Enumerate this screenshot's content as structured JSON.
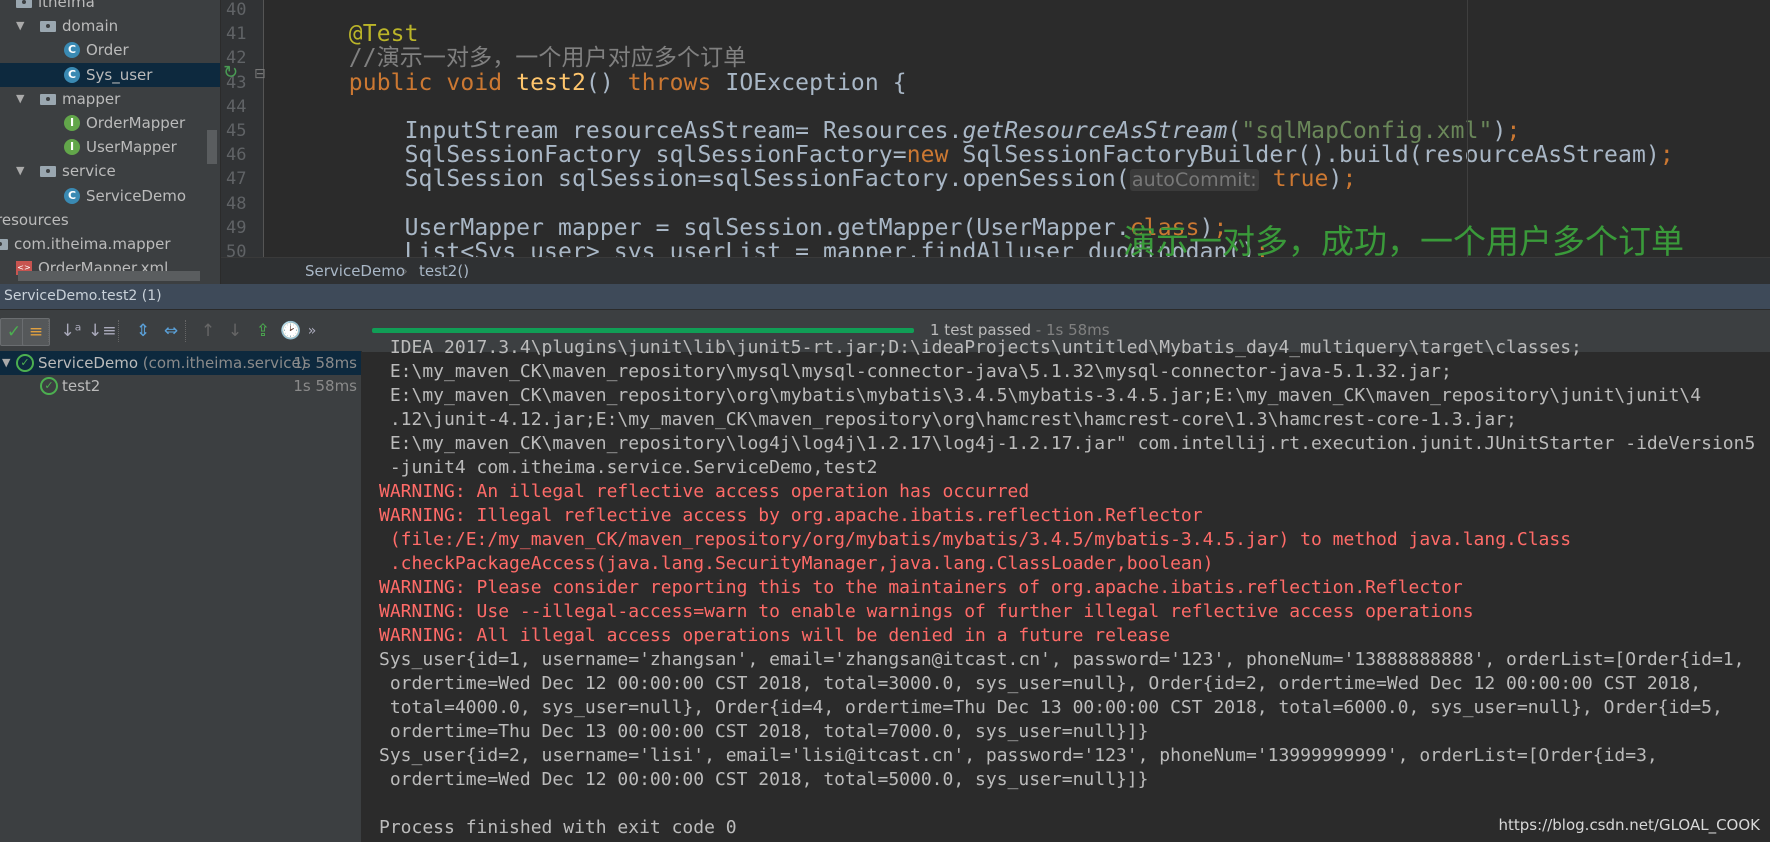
{
  "project_tree": [
    {
      "label": "itheima",
      "type": "folder",
      "indent": 1,
      "expanded": true
    },
    {
      "label": "domain",
      "type": "folder",
      "indent": 2,
      "expanded": true
    },
    {
      "label": "Order",
      "type": "class",
      "indent": 3
    },
    {
      "label": "Sys_user",
      "type": "class",
      "indent": 3,
      "selected": true
    },
    {
      "label": "mapper",
      "type": "folder",
      "indent": 2,
      "expanded": true
    },
    {
      "label": "OrderMapper",
      "type": "interface",
      "indent": 3
    },
    {
      "label": "UserMapper",
      "type": "interface",
      "indent": 3
    },
    {
      "label": "service",
      "type": "folder",
      "indent": 2,
      "expanded": true
    },
    {
      "label": "ServiceDemo",
      "type": "class",
      "indent": 3
    },
    {
      "label": "resources",
      "type": "text",
      "indent": 0
    },
    {
      "label": "com.itheima.mapper",
      "type": "folder",
      "indent": 0
    },
    {
      "label": "OrderMapper.xml",
      "type": "xml",
      "indent": 1
    }
  ],
  "editor": {
    "first_line": 40,
    "lines": [
      [],
      [
        {
          "t": "    "
        },
        {
          "t": "@Test",
          "c": "ann"
        }
      ],
      [
        {
          "t": "    "
        },
        {
          "t": "//演示一对多，一个用户对应多个订单",
          "c": "cmt"
        }
      ],
      [
        {
          "t": "    "
        },
        {
          "t": "public void ",
          "c": "kw"
        },
        {
          "t": "test2",
          "c": "fn"
        },
        {
          "t": "() "
        },
        {
          "t": "throws ",
          "c": "kw"
        },
        {
          "t": "IOException {"
        }
      ],
      [],
      [
        {
          "t": "        InputStream resourceAsStream= Resources."
        },
        {
          "t": "getResourceAsStream",
          "c": "it"
        },
        {
          "t": "("
        },
        {
          "t": "\"sqlMapConfig.xml\"",
          "c": "str"
        },
        {
          "t": ")"
        },
        {
          "t": ";",
          "c": "kw"
        }
      ],
      [
        {
          "t": "        SqlSessionFactory sqlSessionFactory="
        },
        {
          "t": "new ",
          "c": "kw"
        },
        {
          "t": "SqlSessionFactoryBuilder().build(resourceAsStream)"
        },
        {
          "t": ";",
          "c": "kw"
        }
      ],
      [
        {
          "t": "        SqlSession sqlSession=sqlSessionFactory.openSession("
        },
        {
          "t": "autoCommit:",
          "c": "hint"
        },
        {
          "t": " "
        },
        {
          "t": "true",
          "c": "kw"
        },
        {
          "t": ")"
        },
        {
          "t": ";",
          "c": "kw"
        }
      ],
      [],
      [
        {
          "t": "        UserMapper mapper = sqlSession.getMapper(UserMapper."
        },
        {
          "t": "class",
          "c": "kw"
        },
        {
          "t": ")"
        },
        {
          "t": ";",
          "c": "kw"
        }
      ],
      [
        {
          "t": "        List<Sys_user> sys_userList = mapper.findAlluser_duodingdan()"
        },
        {
          "t": ";",
          "c": "kw"
        }
      ]
    ],
    "annotation": "演示一对多，成功，一个用户多个订单",
    "annotation_color": "#3a9a3a",
    "breadcrumb": [
      "ServiceDemo",
      "test2()"
    ]
  },
  "run": {
    "title": "ServiceDemo.test2 (1)",
    "progress": 1.0,
    "status": "1 test passed",
    "status_time": "- 1s 58ms",
    "tree": [
      {
        "label": "ServiceDemo",
        "sub": "(com.itheima.service)",
        "time": "1s 58ms",
        "selected": true
      },
      {
        "label": "test2",
        "sub": "",
        "time": "1s 58ms"
      }
    ],
    "console": [
      {
        "t": " IDEA 2017.3.4\\plugins\\junit\\lib\\junit5-rt.jar;D:\\ideaProjects\\untitled\\Mybatis_day4_multiquery\\target\\classes;"
      },
      {
        "t": " E:\\my_maven_CK\\maven_repository\\mysql\\mysql-connector-java\\5.1.32\\mysql-connector-java-5.1.32.jar;"
      },
      {
        "t": " E:\\my_maven_CK\\maven_repository\\org\\mybatis\\mybatis\\3.4.5\\mybatis-3.4.5.jar;E:\\my_maven_CK\\maven_repository\\junit\\junit\\4"
      },
      {
        "t": " .12\\junit-4.12.jar;E:\\my_maven_CK\\maven_repository\\org\\hamcrest\\hamcrest-core\\1.3\\hamcrest-core-1.3.jar;"
      },
      {
        "t": " E:\\my_maven_CK\\maven_repository\\log4j\\log4j\\1.2.17\\log4j-1.2.17.jar\" com.intellij.rt.execution.junit.JUnitStarter -ideVersion5"
      },
      {
        "t": " -junit4 com.itheima.service.ServiceDemo,test2"
      },
      {
        "t": "WARNING: An illegal reflective access operation has occurred",
        "w": true
      },
      {
        "t": "WARNING: Illegal reflective access by org.apache.ibatis.reflection.Reflector",
        "w": true
      },
      {
        "t": " (file:/E:/my_maven_CK/maven_repository/org/mybatis/mybatis/3.4.5/mybatis-3.4.5.jar) to method java.lang.Class",
        "w": true
      },
      {
        "t": " .checkPackageAccess(java.lang.SecurityManager,java.lang.ClassLoader,boolean)",
        "w": true
      },
      {
        "t": "WARNING: Please consider reporting this to the maintainers of org.apache.ibatis.reflection.Reflector",
        "w": true
      },
      {
        "t": "WARNING: Use --illegal-access=warn to enable warnings of further illegal reflective access operations",
        "w": true
      },
      {
        "t": "WARNING: All illegal access operations will be denied in a future release",
        "w": true
      },
      {
        "t": "Sys_user{id=1, username='zhangsan', email='zhangsan@itcast.cn', password='123', phoneNum='13888888888', orderList=[Order{id=1,"
      },
      {
        "t": " ordertime=Wed Dec 12 00:00:00 CST 2018, total=3000.0, sys_user=null}, Order{id=2, ordertime=Wed Dec 12 00:00:00 CST 2018,"
      },
      {
        "t": " total=4000.0, sys_user=null}, Order{id=4, ordertime=Thu Dec 13 00:00:00 CST 2018, total=6000.0, sys_user=null}, Order{id=5,"
      },
      {
        "t": " ordertime=Thu Dec 13 00:00:00 CST 2018, total=7000.0, sys_user=null}]}"
      },
      {
        "t": "Sys_user{id=2, username='lisi', email='lisi@itcast.cn', password='123', phoneNum='13999999999', orderList=[Order{id=3,"
      },
      {
        "t": " ordertime=Wed Dec 12 00:00:00 CST 2018, total=5000.0, sys_user=null}]}"
      },
      {
        "t": ""
      },
      {
        "t": "Process finished with exit code 0"
      }
    ]
  },
  "watermark": "https://blog.csdn.net/GLOAL_COOK",
  "toolbar_icons": [
    "show-passed-icon",
    "show-ignored-icon",
    "sort-alpha-icon",
    "sort-duration-icon",
    "expand-all-icon",
    "collapse-all-icon",
    "previous-failed-icon",
    "next-failed-icon",
    "export-icon",
    "history-icon",
    "more-icon"
  ]
}
